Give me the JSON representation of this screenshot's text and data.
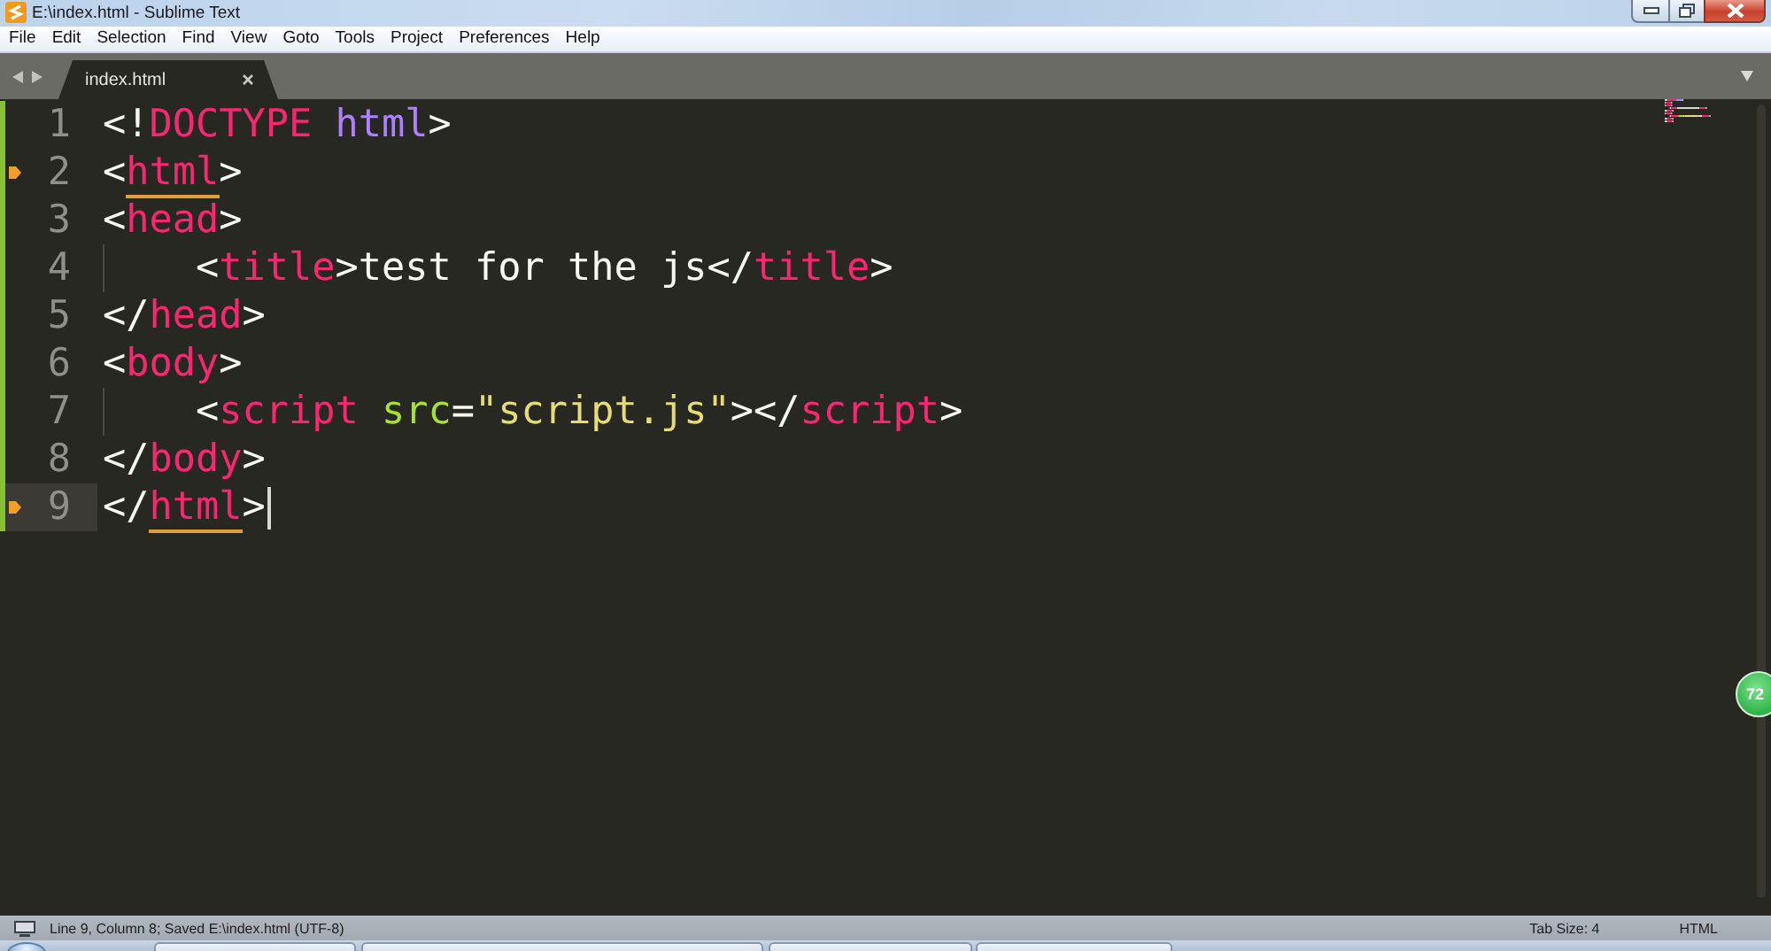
{
  "window": {
    "title": "E:\\index.html - Sublime Text"
  },
  "menu": [
    "File",
    "Edit",
    "Selection",
    "Find",
    "View",
    "Goto",
    "Tools",
    "Project",
    "Preferences",
    "Help"
  ],
  "tabs": [
    {
      "label": "index.html",
      "selected": true
    }
  ],
  "editor": {
    "lines": [
      {
        "number": "1",
        "bookmark": false,
        "current": false,
        "indented": false,
        "tokens": [
          {
            "kind": "text",
            "text": "<!"
          },
          {
            "kind": "keyword",
            "text": "DOCTYPE"
          },
          {
            "kind": "constant",
            "text": " html"
          },
          {
            "kind": "text",
            "text": ">"
          }
        ]
      },
      {
        "number": "2",
        "bookmark": true,
        "current": false,
        "indented": false,
        "tokens": [
          {
            "kind": "text",
            "text": "<"
          },
          {
            "kind": "tag",
            "text": "html",
            "matched": true
          },
          {
            "kind": "text",
            "text": ">"
          }
        ]
      },
      {
        "number": "3",
        "bookmark": false,
        "current": false,
        "indented": false,
        "tokens": [
          {
            "kind": "text",
            "text": "<"
          },
          {
            "kind": "tag",
            "text": "head",
            "matched": false
          },
          {
            "kind": "text",
            "text": ">"
          }
        ]
      },
      {
        "number": "4",
        "bookmark": false,
        "current": false,
        "indented": true,
        "tokens": [
          {
            "kind": "text",
            "text": "<"
          },
          {
            "kind": "tag",
            "text": "title",
            "matched": false
          },
          {
            "kind": "text",
            "text": ">test for the js</"
          },
          {
            "kind": "tag",
            "text": "title",
            "matched": false
          },
          {
            "kind": "text",
            "text": ">"
          }
        ]
      },
      {
        "number": "5",
        "bookmark": false,
        "current": false,
        "indented": false,
        "tokens": [
          {
            "kind": "text",
            "text": "</"
          },
          {
            "kind": "tag",
            "text": "head",
            "matched": false
          },
          {
            "kind": "text",
            "text": ">"
          }
        ]
      },
      {
        "number": "6",
        "bookmark": false,
        "current": false,
        "indented": false,
        "tokens": [
          {
            "kind": "text",
            "text": "<"
          },
          {
            "kind": "tag",
            "text": "body",
            "matched": false
          },
          {
            "kind": "text",
            "text": ">"
          }
        ]
      },
      {
        "number": "7",
        "bookmark": false,
        "current": false,
        "indented": true,
        "tokens": [
          {
            "kind": "text",
            "text": "<"
          },
          {
            "kind": "tag",
            "text": "script",
            "matched": false
          },
          {
            "kind": "attribute",
            "text": " src"
          },
          {
            "kind": "text",
            "text": "="
          },
          {
            "kind": "string",
            "text": "\"script.js\""
          },
          {
            "kind": "text",
            "text": "></"
          },
          {
            "kind": "tag",
            "text": "script",
            "matched": false
          },
          {
            "kind": "text",
            "text": ">"
          }
        ]
      },
      {
        "number": "8",
        "bookmark": false,
        "current": false,
        "indented": false,
        "tokens": [
          {
            "kind": "text",
            "text": "</"
          },
          {
            "kind": "tag",
            "text": "body",
            "matched": false
          },
          {
            "kind": "text",
            "text": ">"
          }
        ]
      },
      {
        "number": "9",
        "bookmark": true,
        "current": true,
        "indented": false,
        "tokens": [
          {
            "kind": "text",
            "text": "</"
          },
          {
            "kind": "tag",
            "text": "html",
            "matched": true
          },
          {
            "kind": "text",
            "text": ">"
          }
        ]
      }
    ]
  },
  "status_bar": {
    "message": "Line 9, Column 8; Saved E:\\index.html (UTF-8)",
    "tab_size": "Tab Size: 4",
    "syntax": "HTML"
  },
  "floating_badge": {
    "text": "72"
  }
}
